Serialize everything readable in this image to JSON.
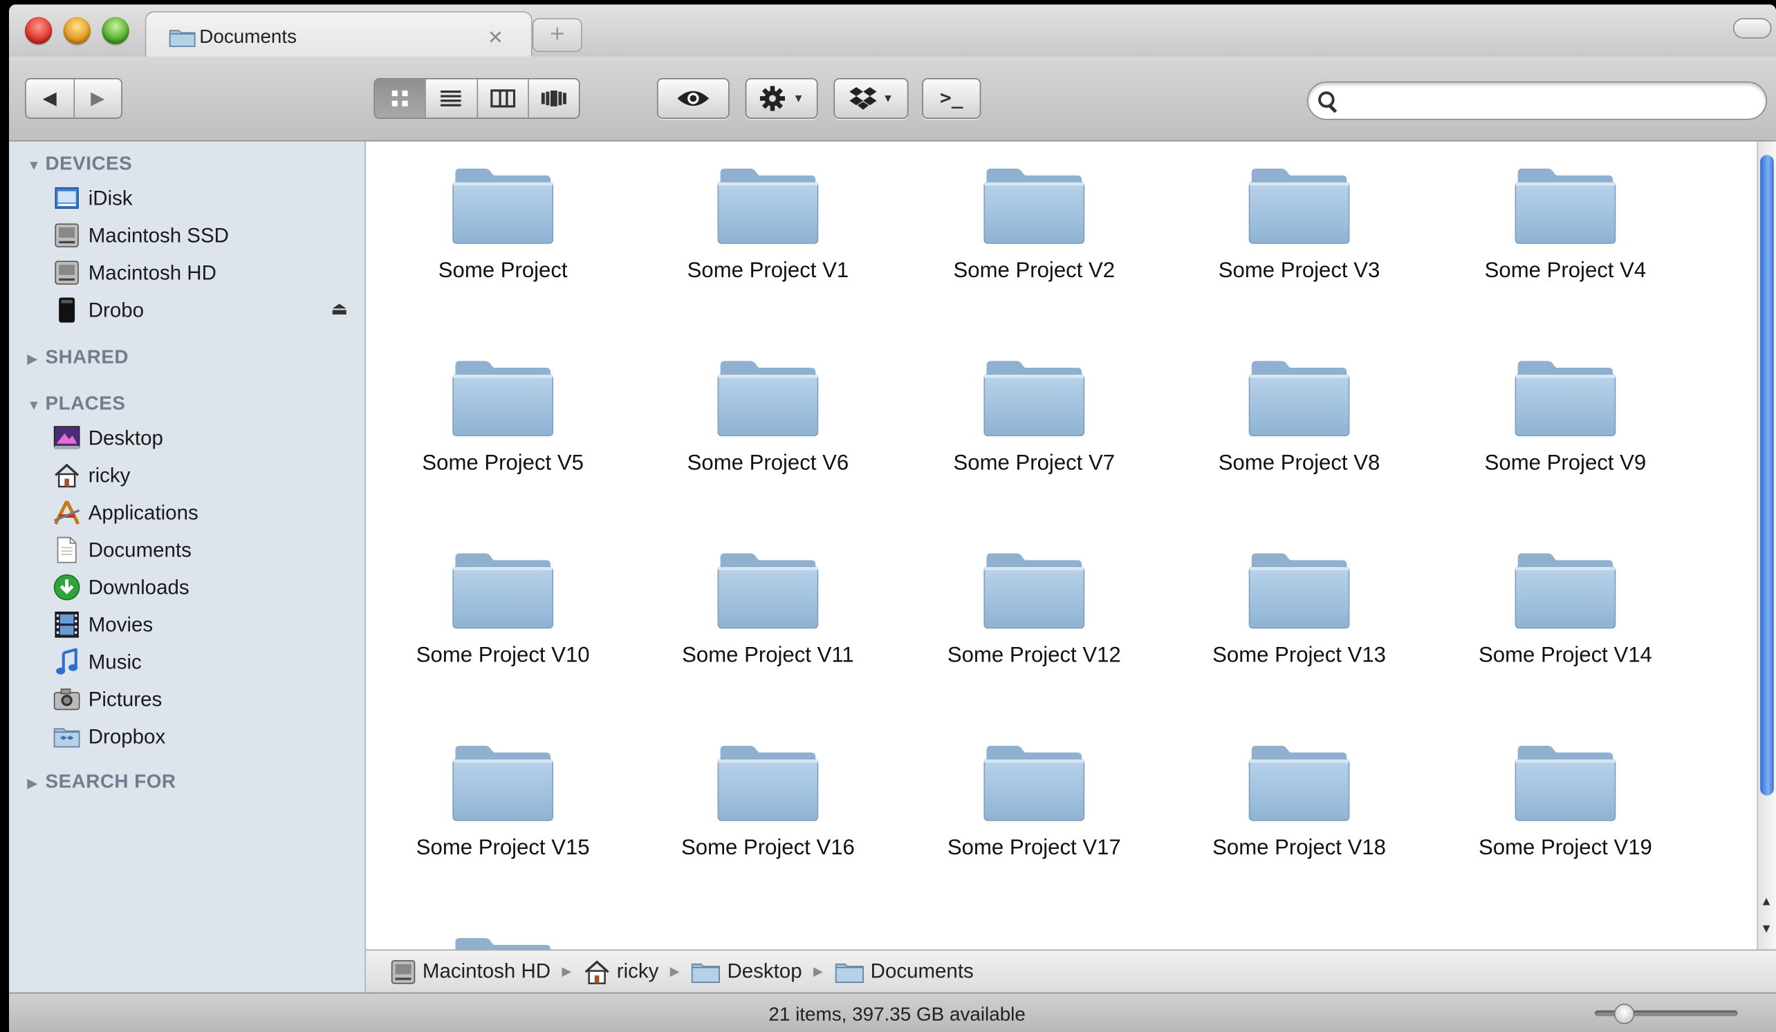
{
  "window": {
    "tab_title": "Documents",
    "tab_close": "×",
    "new_tab": "+"
  },
  "toolbar": {
    "back": "◀",
    "forward": "▶",
    "terminal": ">_",
    "search": {
      "value": "",
      "placeholder": ""
    }
  },
  "sidebar": {
    "devices": {
      "header": "DEVICES",
      "items": [
        {
          "label": "iDisk",
          "icon": "idisk-icon"
        },
        {
          "label": "Macintosh SSD",
          "icon": "hard-drive-icon"
        },
        {
          "label": "Macintosh HD",
          "icon": "hard-drive-icon"
        },
        {
          "label": "Drobo",
          "icon": "drobo-icon"
        }
      ]
    },
    "shared": {
      "header": "SHARED"
    },
    "places": {
      "header": "PLACES",
      "items": [
        {
          "label": "Desktop",
          "icon": "desktop-icon"
        },
        {
          "label": "ricky",
          "icon": "home-icon"
        },
        {
          "label": "Applications",
          "icon": "applications-icon"
        },
        {
          "label": "Documents",
          "icon": "documents-icon"
        },
        {
          "label": "Downloads",
          "icon": "downloads-icon"
        },
        {
          "label": "Movies",
          "icon": "movies-icon"
        },
        {
          "label": "Music",
          "icon": "music-icon"
        },
        {
          "label": "Pictures",
          "icon": "pictures-icon"
        },
        {
          "label": "Dropbox",
          "icon": "dropbox-icon"
        }
      ]
    },
    "search_for": {
      "header": "SEARCH FOR"
    }
  },
  "folders": [
    "Some Project",
    "Some Project V1",
    "Some Project V2",
    "Some Project V3",
    "Some Project V4",
    "Some Project V5",
    "Some Project V6",
    "Some Project V7",
    "Some Project V8",
    "Some Project V9",
    "Some Project V10",
    "Some Project V11",
    "Some Project V12",
    "Some Project V13",
    "Some Project V14",
    "Some Project V15",
    "Some Project V16",
    "Some Project V17",
    "Some Project V18",
    "Some Project V19"
  ],
  "pathbar": [
    {
      "label": "Macintosh HD",
      "icon": "hard-drive-icon"
    },
    {
      "label": "ricky",
      "icon": "home-icon"
    },
    {
      "label": "Desktop",
      "icon": "folder-icon"
    },
    {
      "label": "Documents",
      "icon": "folder-icon"
    }
  ],
  "status": {
    "text": "21 items, 397.35 GB available",
    "zoom_level": 0.15
  },
  "colors": {
    "sidebar_bg": "#dee4ec",
    "folder_blue": "#9fc0dc",
    "scroll_thumb": "#2c6ed8"
  }
}
